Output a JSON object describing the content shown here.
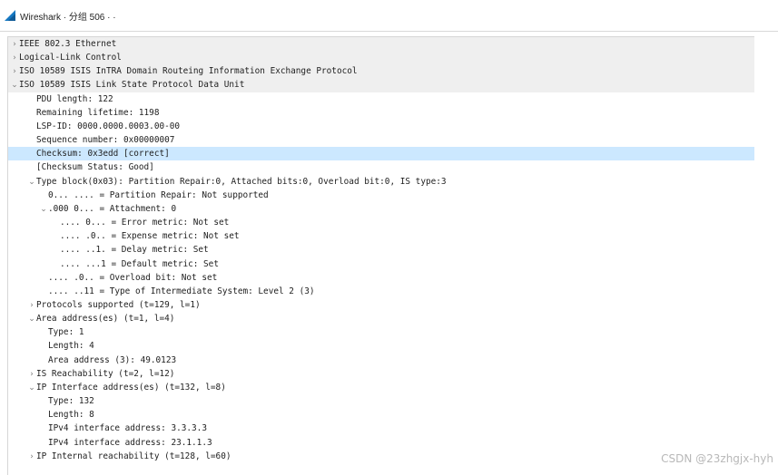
{
  "window": {
    "title": "Wireshark · 分组 506 · ·"
  },
  "watermark": "CSDN @23zhgjx-hyh",
  "colors": {
    "header_bg": "#efefef",
    "selected_bg": "#cce8ff",
    "arrow": "#7a7a7a"
  },
  "icons": {
    "app": "wireshark-fin-icon",
    "collapsed": "chevron-right-icon",
    "expanded": "chevron-down-icon"
  },
  "tree": [
    {
      "text": "IEEE 802.3 Ethernet",
      "level": 0,
      "toggle": "collapsed",
      "style": "header"
    },
    {
      "text": "Logical-Link Control",
      "level": 0,
      "toggle": "collapsed",
      "style": "header"
    },
    {
      "text": "ISO 10589 ISIS InTRA Domain Routeing Information Exchange Protocol",
      "level": 0,
      "toggle": "collapsed",
      "style": "header"
    },
    {
      "text": "ISO 10589 ISIS Link State Protocol Data Unit",
      "level": 0,
      "toggle": "expanded",
      "style": "header"
    },
    {
      "text": "PDU length: 122",
      "level": 1,
      "toggle": "none",
      "style": ""
    },
    {
      "text": "Remaining lifetime: 1198",
      "level": 1,
      "toggle": "none",
      "style": ""
    },
    {
      "text": "LSP-ID: 0000.0000.0003.00-00",
      "level": 1,
      "toggle": "none",
      "style": ""
    },
    {
      "text": "Sequence number: 0x00000007",
      "level": 1,
      "toggle": "none",
      "style": ""
    },
    {
      "text": "Checksum: 0x3edd [correct]",
      "level": 1,
      "toggle": "none",
      "style": "selected"
    },
    {
      "text": "[Checksum Status: Good]",
      "level": 1,
      "toggle": "none",
      "style": ""
    },
    {
      "text": "Type block(0x03): Partition Repair:0, Attached bits:0, Overload bit:0, IS type:3",
      "level": 1,
      "toggle": "expanded",
      "style": ""
    },
    {
      "text": "0... .... = Partition Repair: Not supported",
      "level": 2,
      "toggle": "none",
      "style": ""
    },
    {
      "text": ".000 0... = Attachment: 0",
      "level": 2,
      "toggle": "expanded",
      "style": ""
    },
    {
      "text": ".... 0... = Error metric: Not set",
      "level": 3,
      "toggle": "none",
      "style": ""
    },
    {
      "text": ".... .0.. = Expense metric: Not set",
      "level": 3,
      "toggle": "none",
      "style": ""
    },
    {
      "text": ".... ..1. = Delay metric: Set",
      "level": 3,
      "toggle": "none",
      "style": ""
    },
    {
      "text": ".... ...1 = Default metric: Set",
      "level": 3,
      "toggle": "none",
      "style": ""
    },
    {
      "text": ".... .0.. = Overload bit: Not set",
      "level": 2,
      "toggle": "none",
      "style": ""
    },
    {
      "text": ".... ..11 = Type of Intermediate System: Level 2 (3)",
      "level": 2,
      "toggle": "none",
      "style": ""
    },
    {
      "text": "Protocols supported (t=129, l=1)",
      "level": 1,
      "toggle": "collapsed",
      "style": ""
    },
    {
      "text": "Area address(es) (t=1, l=4)",
      "level": 1,
      "toggle": "expanded",
      "style": ""
    },
    {
      "text": "Type: 1",
      "level": 2,
      "toggle": "none",
      "style": ""
    },
    {
      "text": "Length: 4",
      "level": 2,
      "toggle": "none",
      "style": ""
    },
    {
      "text": "Area address (3): 49.0123",
      "level": 2,
      "toggle": "none",
      "style": ""
    },
    {
      "text": "IS Reachability (t=2, l=12)",
      "level": 1,
      "toggle": "collapsed",
      "style": ""
    },
    {
      "text": "IP Interface address(es) (t=132, l=8)",
      "level": 1,
      "toggle": "expanded",
      "style": ""
    },
    {
      "text": "Type: 132",
      "level": 2,
      "toggle": "none",
      "style": ""
    },
    {
      "text": "Length: 8",
      "level": 2,
      "toggle": "none",
      "style": ""
    },
    {
      "text": "IPv4 interface address: 3.3.3.3",
      "level": 2,
      "toggle": "none",
      "style": ""
    },
    {
      "text": "IPv4 interface address: 23.1.1.3",
      "level": 2,
      "toggle": "none",
      "style": ""
    },
    {
      "text": "IP Internal reachability (t=128, l=60)",
      "level": 1,
      "toggle": "collapsed",
      "style": ""
    }
  ]
}
